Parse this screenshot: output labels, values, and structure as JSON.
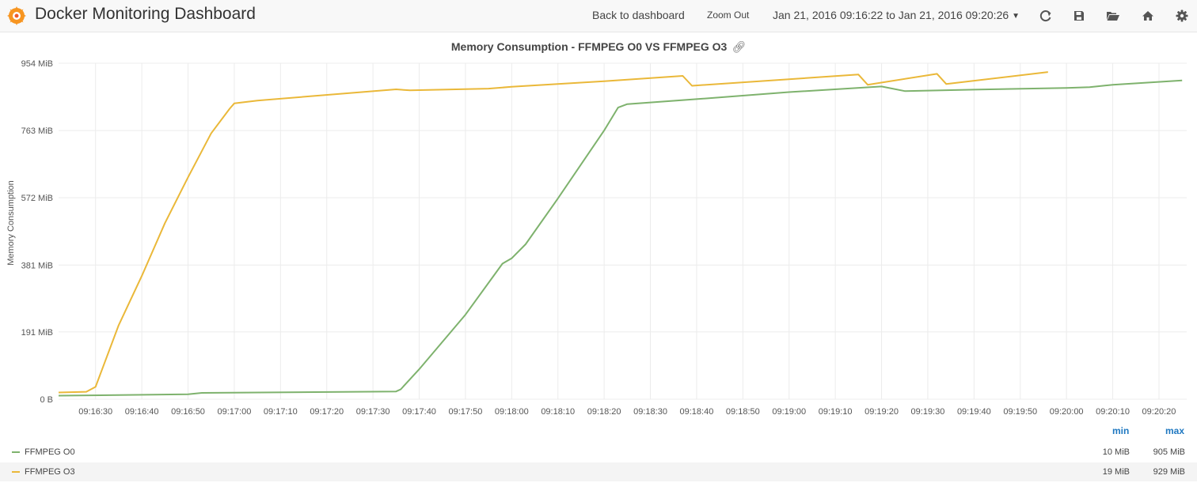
{
  "header": {
    "title": "Docker Monitoring Dashboard",
    "back_label": "Back to dashboard",
    "zoom_label": "Zoom Out",
    "time_range": "Jan 21, 2016 09:16:22 to Jan 21, 2016 09:20:26",
    "icons": [
      "grafana-logo-icon",
      "refresh-icon",
      "save-icon",
      "folder-open-icon",
      "home-icon",
      "settings-gear-icon"
    ]
  },
  "panel": {
    "title": "Memory Consumption - FFMPEG O0 VS FFMPEG O3",
    "link_icon": "chain-link-icon"
  },
  "legend": {
    "min_header": "min",
    "max_header": "max",
    "rows": [
      {
        "name": "FFMPEG O0",
        "min": "10 MiB",
        "max": "905 MiB",
        "color": "#7eb26d"
      },
      {
        "name": "FFMPEG O3",
        "min": "19 MiB",
        "max": "929 MiB",
        "color": "#eab839"
      }
    ]
  },
  "chart_data": {
    "type": "line",
    "title": "Memory Consumption - FFMPEG O0 VS FFMPEG O3",
    "ylabel": "Memory Consumption",
    "xlabel": "",
    "y_unit": "MiB",
    "ylim": [
      0,
      954
    ],
    "yticks": [
      0,
      191,
      381,
      572,
      763,
      954
    ],
    "ytick_labels": [
      "0 B",
      "191 MiB",
      "381 MiB",
      "572 MiB",
      "763 MiB",
      "954 MiB"
    ],
    "xlim": [
      "09:16:22",
      "09:20:26"
    ],
    "xtick_labels": [
      "09:16:30",
      "09:16:40",
      "09:16:50",
      "09:17:00",
      "09:17:10",
      "09:17:20",
      "09:17:30",
      "09:17:40",
      "09:17:50",
      "09:18:00",
      "09:18:10",
      "09:18:20",
      "09:18:30",
      "09:18:40",
      "09:18:50",
      "09:19:00",
      "09:19:10",
      "09:19:20",
      "09:19:30",
      "09:19:40",
      "09:19:50",
      "09:20:00",
      "09:20:10",
      "09:20:20"
    ],
    "grid": true,
    "legend_position": "bottom",
    "series": [
      {
        "name": "FFMPEG O0",
        "color": "#7eb26d",
        "points": [
          [
            "09:16:22",
            10
          ],
          [
            "09:16:50",
            14
          ],
          [
            "09:16:53",
            18
          ],
          [
            "09:17:35",
            22
          ],
          [
            "09:17:36",
            28
          ],
          [
            "09:17:40",
            85
          ],
          [
            "09:17:50",
            240
          ],
          [
            "09:17:58",
            385
          ],
          [
            "09:18:00",
            400
          ],
          [
            "09:18:03",
            440
          ],
          [
            "09:18:10",
            570
          ],
          [
            "09:18:20",
            763
          ],
          [
            "09:18:23",
            828
          ],
          [
            "09:18:25",
            838
          ],
          [
            "09:18:40",
            852
          ],
          [
            "09:19:00",
            872
          ],
          [
            "09:19:20",
            888
          ],
          [
            "09:19:25",
            875
          ],
          [
            "09:19:40",
            879
          ],
          [
            "09:20:00",
            884
          ],
          [
            "09:20:05",
            886
          ],
          [
            "09:20:10",
            893
          ],
          [
            "09:20:25",
            905
          ]
        ]
      },
      {
        "name": "FFMPEG O3",
        "color": "#eab839",
        "points": [
          [
            "09:16:22",
            19
          ],
          [
            "09:16:28",
            21
          ],
          [
            "09:16:30",
            35
          ],
          [
            "09:16:35",
            210
          ],
          [
            "09:16:40",
            350
          ],
          [
            "09:16:45",
            500
          ],
          [
            "09:16:50",
            630
          ],
          [
            "09:16:55",
            755
          ],
          [
            "09:16:59",
            825
          ],
          [
            "09:17:00",
            840
          ],
          [
            "09:17:05",
            848
          ],
          [
            "09:17:35",
            880
          ],
          [
            "09:17:38",
            877
          ],
          [
            "09:17:55",
            882
          ],
          [
            "09:18:00",
            887
          ],
          [
            "09:18:20",
            903
          ],
          [
            "09:18:37",
            918
          ],
          [
            "09:18:39",
            890
          ],
          [
            "09:19:15",
            922
          ],
          [
            "09:19:17",
            893
          ],
          [
            "09:19:32",
            924
          ],
          [
            "09:19:34",
            895
          ],
          [
            "09:19:56",
            929
          ]
        ]
      }
    ]
  }
}
